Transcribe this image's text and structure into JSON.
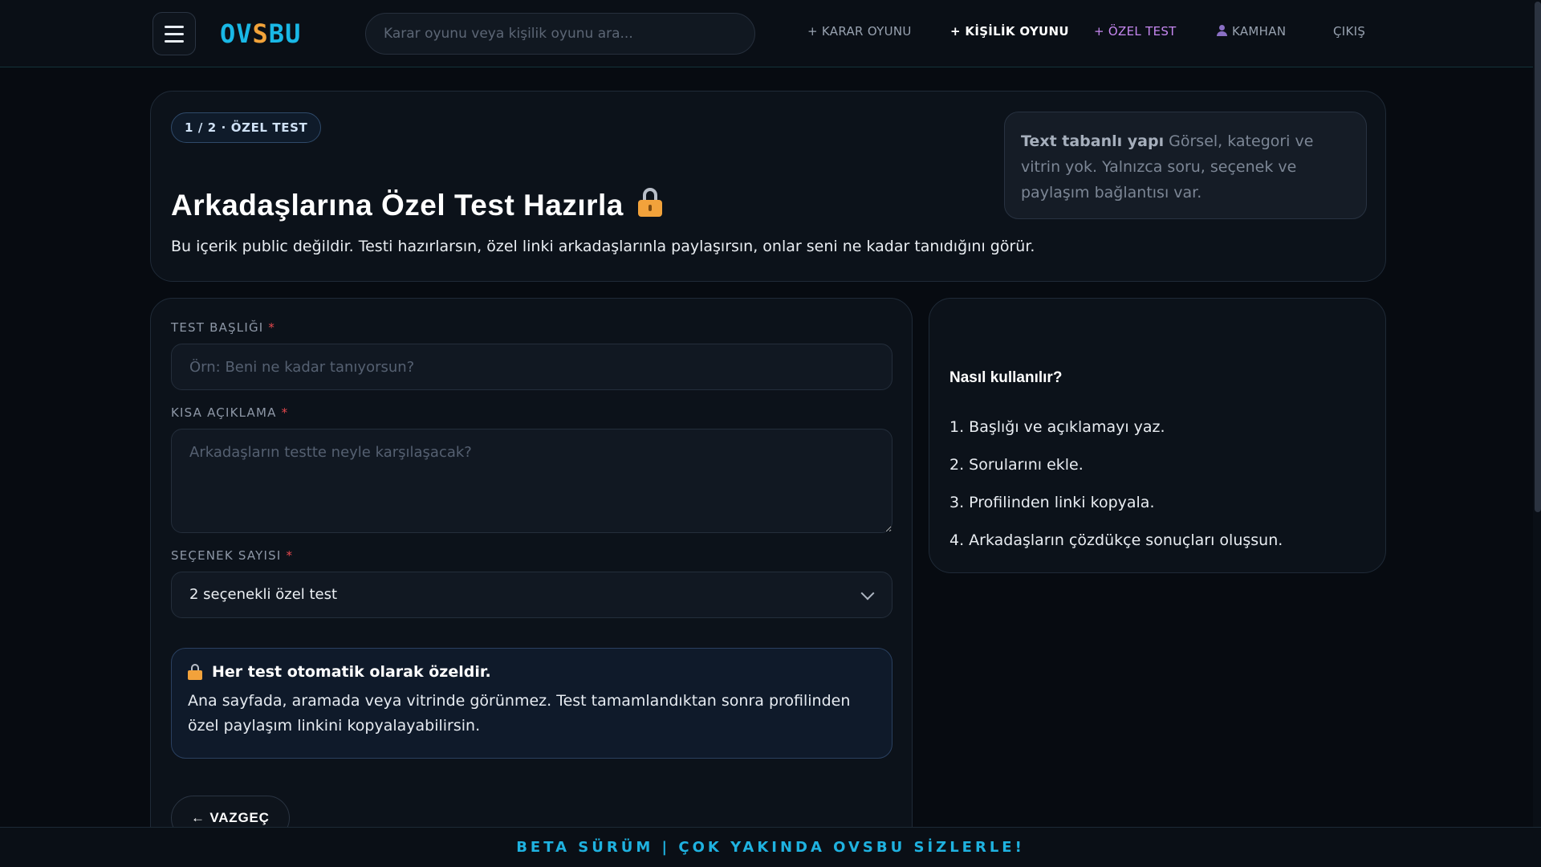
{
  "header": {
    "logo_left": "OV",
    "logo_s": "S",
    "logo_right": "BU",
    "search_placeholder": "Karar oyunu veya kişilik oyunu ara...",
    "nav": {
      "karar": "+ KARAR OYUNU",
      "kisilik": "+ KİŞİLİK OYUNU",
      "ozel": "+ ÖZEL TEST",
      "user": "KAMHAN",
      "exit": "ÇIKIŞ"
    },
    "colors": {
      "accent": "#19b8e6",
      "logo_accent": "#f2a33a",
      "ozel_link": "#c687f0"
    }
  },
  "hero": {
    "step_pill": "1 / 2 · ÖZEL TEST",
    "title": "Arkadaşlarına Özel Test Hazırla",
    "subtitle": "Bu içerik public değildir. Testi hazırlarsın, özel linki arkadaşlarınla paylaşırsın, onlar seni ne kadar tanıdığını görür.",
    "info_bold": "Text tabanlı yapı",
    "info_text": " Görsel, kategori ve vitrin yok. Yalnızca soru, seçenek ve paylaşım bağlantısı var."
  },
  "form": {
    "title_label": "TEST BAŞLIĞI",
    "title_placeholder": "Örn: Beni ne kadar tanıyorsun?",
    "desc_label": "KISA AÇIKLAMA",
    "desc_placeholder": "Arkadaşların testte neyle karşılaşacak?",
    "options_label": "SEÇENEK SAYISI",
    "options_value": "2 seçenekli özel test",
    "required_mark": "*",
    "notice_title": "Her test otomatik olarak özeldir.",
    "notice_text": "Ana sayfada, aramada veya vitrinde görünmez. Test tamamlandıktan sonra profilinden özel paylaşım linkini kopyalayabilirsin.",
    "back_button": "← VAZGEÇ"
  },
  "help": {
    "title": "Nasıl kullanılır?",
    "steps": [
      "1. Başlığı ve açıklamayı yaz.",
      "2. Sorularını ekle.",
      "3. Profilinden linki kopyala.",
      "4. Arkadaşların çözdükçe sonuçları oluşsun."
    ]
  },
  "footer": {
    "banner": "BETA SÜRÜM | ÇOK YAKINDA OVSBU SİZLERLE!"
  }
}
